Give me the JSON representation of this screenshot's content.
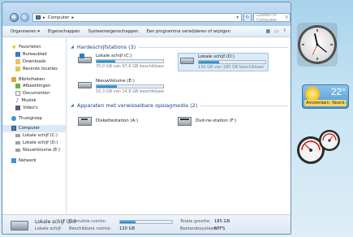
{
  "window": {
    "address": "Computer",
    "search_placeholder": "Zoeken in Computer"
  },
  "toolbar": {
    "items": [
      "Organiseren ▾",
      "Eigenschappen",
      "Systeemeigenschappen",
      "Een programma verwijderen of wijzigen"
    ]
  },
  "sidebar": {
    "favorites": "Favorieten",
    "fav_items": [
      "Bureaublad",
      "Downloads",
      "Recente locaties"
    ],
    "libraries": "Bibliotheken",
    "lib_items": [
      "Afbeeldingen",
      "Documenten",
      "Muziek",
      "Video's"
    ],
    "homegroup": "Thuisgroep",
    "computer": "Computer",
    "comp_items": [
      "Lokale schijf (C:)",
      "Lokale schijf (D:)",
      "NieuwVolume (E:)"
    ],
    "network": "Netwerk"
  },
  "main": {
    "hdd_header": "Hardeschijfstations (3)",
    "drives": [
      {
        "name": "Lokale schijf (C:)",
        "space": "70,0 GB van 97,6 GB beschikbaar",
        "used_fraction": 0.28
      },
      {
        "name": "Lokale schijf (D:)",
        "space": "130 GB van 185 GB beschikbaar",
        "used_fraction": 0.3
      },
      {
        "name": "NieuwVolume (E:)",
        "space": "10,3 GB van 14,8 GB beschikbaar",
        "used_fraction": 0.3
      }
    ],
    "removable_header": "Apparaten met verwisselbare opslagmedia (2)",
    "removable": [
      {
        "name": "Diskettestation (A:)"
      },
      {
        "name": "Dvd-rw-station (F:)"
      }
    ]
  },
  "status": {
    "drive_name": "Lokale schijf (D:)",
    "drive_type": "Lokale schijf",
    "used_label": "Gebruikte ruimte:",
    "free_label": "Beschikbare ruimte:",
    "free_value": "130 GB",
    "total_label": "Totale grootte:",
    "total_value": "185 GB",
    "fs_label": "Bestandssysteem:",
    "fs_value": "NTFS",
    "used_fraction": 0.3
  },
  "gadgets": {
    "weather_temp": "22°",
    "weather_city": "Amsterdam, Noord-..."
  }
}
